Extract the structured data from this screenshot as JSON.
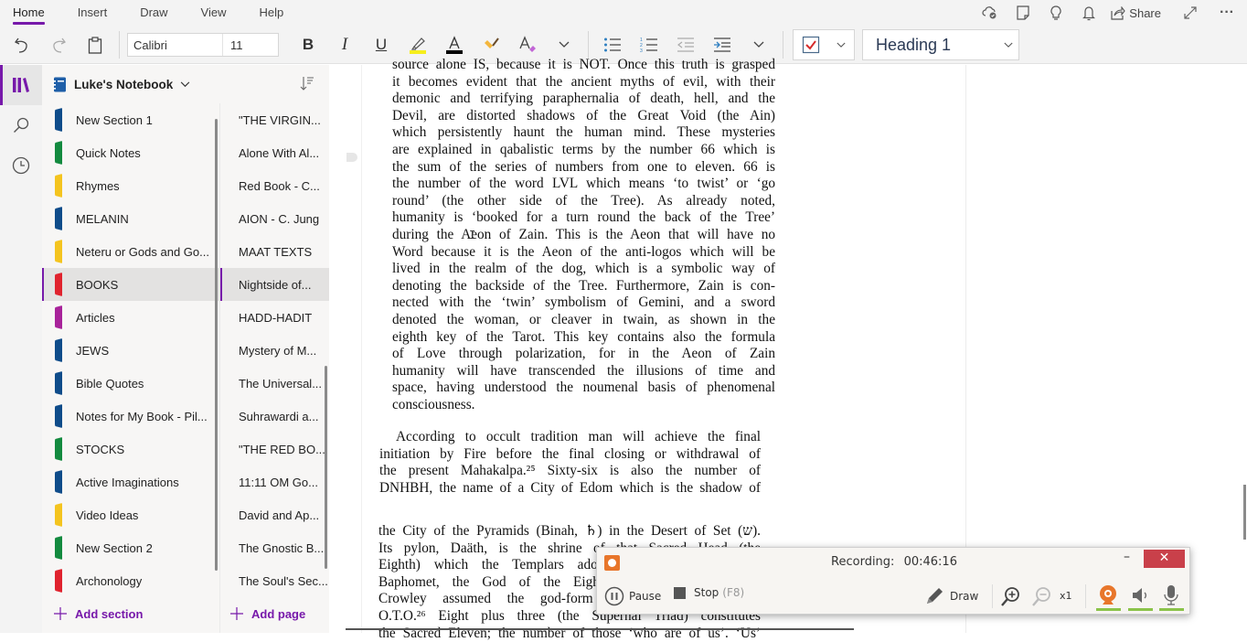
{
  "ribbon": {
    "tabs": [
      {
        "label": "Home",
        "active": true
      },
      {
        "label": "Insert"
      },
      {
        "label": "Draw"
      },
      {
        "label": "View"
      },
      {
        "label": "Help"
      }
    ],
    "share_label": "Share",
    "font_name": "Calibri",
    "font_size": "11",
    "style_value": "Heading 1",
    "icons": {
      "sync": "cloud-sync-icon",
      "pages": "page-icon",
      "tell": "lightbulb-icon",
      "notify": "bell-icon",
      "expand": "expand-icon",
      "more": "more-icon"
    }
  },
  "notebook": {
    "title": "Luke's Notebook",
    "sections": [
      {
        "label": "New Section 1",
        "color": "#0f4c8a"
      },
      {
        "label": "Quick Notes",
        "color": "#138a3f"
      },
      {
        "label": "Rhymes",
        "color": "#f4c41f"
      },
      {
        "label": "MELANIN",
        "color": "#0f4c8a"
      },
      {
        "label": "Neteru or Gods and Go...",
        "color": "#f4c41f"
      },
      {
        "label": "BOOKS",
        "color": "#e0232e",
        "active": true
      },
      {
        "label": "Articles",
        "color": "#a8239a"
      },
      {
        "label": "JEWS",
        "color": "#0f4c8a"
      },
      {
        "label": "Bible Quotes",
        "color": "#0f4c8a"
      },
      {
        "label": "Notes for My Book - Pil...",
        "color": "#0f4c8a"
      },
      {
        "label": "STOCKS",
        "color": "#138a3f"
      },
      {
        "label": "Active Imaginations",
        "color": "#0f4c8a"
      },
      {
        "label": "Video Ideas",
        "color": "#f4c41f"
      },
      {
        "label": "New Section 2",
        "color": "#138a3f"
      },
      {
        "label": "Archonology",
        "color": "#e0232e"
      }
    ],
    "pages": [
      {
        "label": "\"THE VIRGIN..."
      },
      {
        "label": "Alone With Al..."
      },
      {
        "label": "Red Book - C..."
      },
      {
        "label": "AION - C. Jung"
      },
      {
        "label": "MAAT TEXTS"
      },
      {
        "label": "Nightside of...",
        "active": true
      },
      {
        "label": "HADD-HADIT"
      },
      {
        "label": "Mystery of M..."
      },
      {
        "label": "The Universal..."
      },
      {
        "label": "Suhrawardi a..."
      },
      {
        "label": "\"THE RED BO..."
      },
      {
        "label": "11:11 OM Go..."
      },
      {
        "label": "David and Ap..."
      },
      {
        "label": "The Gnostic B..."
      },
      {
        "label": "The Soul's Sec..."
      }
    ],
    "add_section": "Add section",
    "add_page": "Add page"
  },
  "content": {
    "block1": [
      "source alone IS, because it is NOT. Once this truth is grasped",
      "it becomes evident that the ancient myths of evil, with their",
      "demonic and terrifying paraphernalia of death, hell, and the",
      "Devil, are distorted shadows of the Great Void (the Ain)",
      "which persistently haunt the human mind. These mysteries",
      "are explained in qabalistic terms by the number 66 which is",
      "the sum of the series of numbers from one to eleven. 66 is",
      "the number of the word LVL which means ‘to twist’ or ‘go",
      "round’ (the other side of the Tree). As already noted,",
      "humanity is ‘booked for a turn round the back of the Tree’",
      "during the Aeon of Zain. This is the Aeon that will have no",
      "Word because it is the Aeon of the anti-logos which will be",
      "lived in the realm of the dog, which is a symbolic way of",
      "denoting the backside of the Tree. Furthermore, Zain is con-",
      "nected with the ‘twin’ symbolism of Gemini, and a sword",
      "denoted the woman, or cleaver in twain, as shown in the",
      "eighth key of the Tarot. This key contains also the formula",
      "of Love through polarization, for in the Aeon of Zain",
      "humanity will have transcended the illusions of time and",
      "space, having understood the noumenal basis of phenomenal",
      "consciousness."
    ],
    "block2": [
      "According to occult tradition man will achieve the final",
      "initiation by Fire before the final closing or withdrawal of",
      "the present Mahakalpa.²⁵ Sixty-six is also the number of",
      "DNHBH, the name of a City of Edom which is the shadow of"
    ],
    "block3": [
      "the City of the Pyramids (Binah, ♄) in the Desert of Set (ש).",
      "Its pylon, Daäth, is the shrine of that Sacred Head (the",
      "Eighth) which the Templars adored under the name of",
      "Baphomet, the God of the Eight. In this form Aleister",
      "Crowley assumed the god-form of the Head of the",
      "O.T.O.²⁶ Eight plus three (the Supernal Triad) constitutes",
      "the Sacred Eleven; the number of those ‘who are of us’. ‘Us’"
    ]
  },
  "recorder": {
    "title": "Recording:",
    "time": "00:46:16",
    "pause": "Pause",
    "stop": "Stop",
    "stop_hint": "(F8)",
    "draw": "Draw",
    "zoom_level": "x1"
  }
}
